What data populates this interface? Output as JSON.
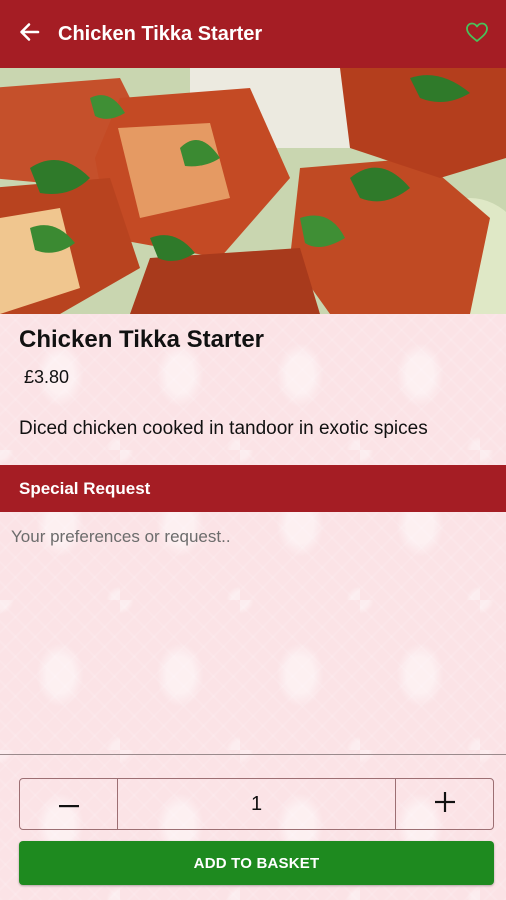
{
  "header": {
    "title": "Chicken Tikka Starter",
    "back_icon": "arrow-left-icon",
    "favorite_icon": "heart-outline-icon"
  },
  "product": {
    "image_alt_icon": "food-photo",
    "name": "Chicken Tikka Starter",
    "price": "£3.80",
    "description": "Diced chicken cooked in tandoor in exotic spices"
  },
  "special_request": {
    "heading": "Special Request",
    "placeholder": "Your preferences or request..",
    "value": ""
  },
  "quantity": {
    "minus_label": "−",
    "value": "1",
    "plus_label": "+"
  },
  "actions": {
    "add_to_basket": "ADD TO BASKET"
  },
  "colors": {
    "brand_red": "#a51d24",
    "action_green": "#1e8a1f",
    "background_pink": "#fbe3e6",
    "favorite_green": "#49c15a"
  }
}
